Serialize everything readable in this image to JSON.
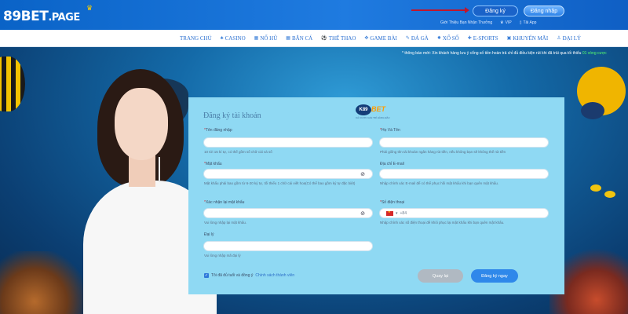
{
  "header": {
    "logo_main": "89BET",
    "logo_suffix": ".PAGE",
    "register_label": "Đăng ký",
    "login_label": "Đăng nhập",
    "links": [
      "Giới Thiệu Bạn Nhận Thưởng",
      "VIP",
      "Tải App"
    ]
  },
  "nav": {
    "items": [
      "TRANG CHỦ",
      "CASINO",
      "NỔ HŨ",
      "BẮN CÁ",
      "THỂ THAO",
      "GAME BÀI",
      "ĐÁ GÀ",
      "XỔ SỐ",
      "E-SPORTS",
      "KHUYẾN MÃI",
      "ĐẠI LÝ"
    ]
  },
  "banner": {
    "marquee": "* thông báo mới: Xin khách hàng lưu ý cổng số tiền hoàn trả chỉ đủ điều kiện rút khi đã trải qua tối thiểu",
    "marquee_highlight": "01 vòng cược",
    "accent": "#58ff6c"
  },
  "form": {
    "title": "Đăng ký tài khoản",
    "logo_text": "BET",
    "logo_badge": "K89",
    "logo_sub": "CÁ CƯỢC GIẢI TRÍ HÀNG ĐẦU",
    "fields": {
      "username": {
        "label": "Tên đăng nhập",
        "value": "",
        "hint": "10 tới 15 kí tự, có thể gồm số chữ cái và số"
      },
      "fullname": {
        "label": "Họ Và Tên",
        "value": "",
        "hint": "Phải giống tên tài khoản ngân hàng rút tiền, nếu không bạn sẽ không thể rút tiền"
      },
      "password": {
        "label": "Mật khẩu",
        "value": "",
        "hint": "Mật khẩu phải bao gồm từ 6-20 ký tự, tối thiểu 1 chữ cái viết hoa(Có thể bao gồm ký tự đặc biệt)"
      },
      "email": {
        "label": "Địa chỉ E-mail",
        "value": "",
        "hint": "Nhập chính xác E-mail để có thể phục hồi mật khẩu khi bạn quên mật khẩu."
      },
      "confirm": {
        "label": "Xác nhận lại mật khẩu",
        "value": "",
        "hint": "Vui lòng nhập lại mật khẩu."
      },
      "phone": {
        "label": "Số điện thoại",
        "value": "+84",
        "hint": "Nhập chính xác số điện thoại để khôi phục lại mật khẩu khi bạn quên mật khẩu."
      },
      "agent": {
        "label": "Đại lý",
        "value": "",
        "hint": "Vui lòng nhập mã đại lý"
      }
    },
    "agree_text": "Tôi đã đủ tuổi và đồng ý",
    "agree_link": "Chính sách thành viên",
    "back_label": "Quay lại",
    "submit_label": "Đăng ký ngay"
  }
}
